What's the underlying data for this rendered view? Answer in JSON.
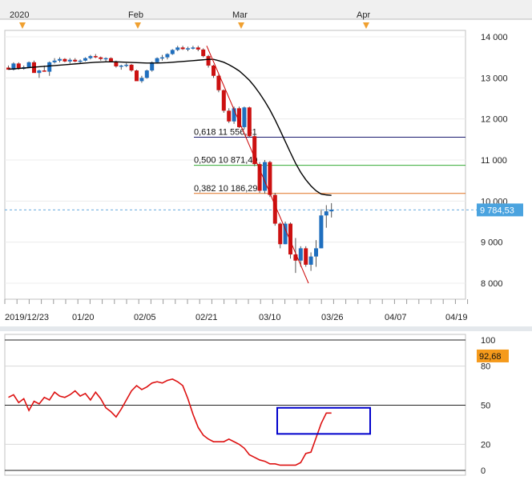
{
  "chart_data": [
    {
      "type": "candlestick",
      "top_axis": {
        "labels": [
          "2020",
          "Feb",
          "Mar",
          "Apr"
        ]
      },
      "y_axis": {
        "ticks": [
          8000,
          9000,
          10000,
          11000,
          12000,
          13000,
          14000
        ],
        "tick_labels": [
          "8 000",
          "9 000",
          "10 000",
          "11 000",
          "12 000",
          "13 000",
          "14 000"
        ],
        "range": [
          7700,
          14150
        ]
      },
      "x_axis": {
        "tick_labels": [
          "2019/12/23",
          "01/20",
          "02/05",
          "02/21",
          "03/10",
          "03/26",
          "04/07",
          "04/19"
        ]
      },
      "current_price": {
        "label": "9 784,53",
        "value": 9784.53,
        "color": "#3399cc"
      },
      "fibonacci_levels": [
        {
          "label": "0,618 11 556,31",
          "value": 11556.31,
          "color": "#1a1a6e"
        },
        {
          "label": "0,500 10 871,40",
          "value": 10871.4,
          "color": "#33aa33"
        },
        {
          "label": "0,382 10 186,29",
          "value": 10186.29,
          "color": "#e07020"
        }
      ],
      "trendline": {
        "from": 13780,
        "to": 8000,
        "color": "#cc0000"
      },
      "colors": {
        "up": "#1f6fbf",
        "down": "#cc1111",
        "moving_average": "#000000",
        "grid": "#cccccc"
      },
      "candles": [
        [
          13250,
          13300,
          13200,
          13200
        ],
        [
          13200,
          13380,
          13180,
          13350
        ],
        [
          13350,
          13380,
          13200,
          13220
        ],
        [
          13220,
          13300,
          13200,
          13260
        ],
        [
          13260,
          13400,
          13250,
          13380
        ],
        [
          13380,
          13420,
          13300,
          13120
        ],
        [
          13120,
          13200,
          13000,
          13180
        ],
        [
          13180,
          13300,
          13150,
          13150
        ],
        [
          13150,
          13400,
          13050,
          13380
        ],
        [
          13380,
          13480,
          13350,
          13420
        ],
        [
          13420,
          13500,
          13380,
          13460
        ],
        [
          13460,
          13480,
          13380,
          13400
        ],
        [
          13400,
          13480,
          13350,
          13440
        ],
        [
          13440,
          13480,
          13380,
          13400
        ],
        [
          13400,
          13450,
          13360,
          13420
        ],
        [
          13420,
          13500,
          13400,
          13480
        ],
        [
          13480,
          13560,
          13450,
          13530
        ],
        [
          13530,
          13580,
          13480,
          13500
        ],
        [
          13500,
          13520,
          13420,
          13460
        ],
        [
          13460,
          13500,
          13400,
          13480
        ],
        [
          13480,
          13500,
          13380,
          13400
        ],
        [
          13400,
          13420,
          13250,
          13280
        ],
        [
          13280,
          13320,
          13200,
          13300
        ],
        [
          13300,
          13360,
          13260,
          13320
        ],
        [
          13320,
          13340,
          13150,
          13180
        ],
        [
          13180,
          13200,
          12950,
          12920
        ],
        [
          12920,
          13050,
          12880,
          13000
        ],
        [
          13000,
          13200,
          12980,
          13180
        ],
        [
          13180,
          13400,
          13150,
          13380
        ],
        [
          13380,
          13500,
          13350,
          13480
        ],
        [
          13480,
          13560,
          13420,
          13500
        ],
        [
          13500,
          13600,
          13450,
          13580
        ],
        [
          13580,
          13700,
          13560,
          13680
        ],
        [
          13680,
          13780,
          13650,
          13740
        ],
        [
          13740,
          13780,
          13680,
          13700
        ],
        [
          13700,
          13760,
          13650,
          13720
        ],
        [
          13720,
          13780,
          13690,
          13740
        ],
        [
          13740,
          13780,
          13650,
          13690
        ],
        [
          13690,
          13720,
          13500,
          13530
        ],
        [
          13530,
          13560,
          13250,
          13300
        ],
        [
          13300,
          13320,
          13000,
          13050
        ],
        [
          13050,
          13080,
          12650,
          12700
        ],
        [
          12700,
          12720,
          12150,
          12200
        ],
        [
          12200,
          12260,
          11900,
          11940
        ],
        [
          11940,
          12300,
          11880,
          12260
        ],
        [
          12260,
          12300,
          11780,
          11800
        ],
        [
          11800,
          12300,
          11750,
          12280
        ],
        [
          12280,
          12300,
          11550,
          11580
        ],
        [
          11580,
          11620,
          10850,
          10900
        ],
        [
          10900,
          10950,
          10200,
          10250
        ],
        [
          10250,
          11000,
          10180,
          10950
        ],
        [
          10950,
          10980,
          10100,
          10150
        ],
        [
          10150,
          10200,
          9400,
          9450
        ],
        [
          9450,
          9480,
          8850,
          8950
        ],
        [
          8950,
          9500,
          8950,
          9450
        ],
        [
          9450,
          9480,
          8600,
          8700
        ],
        [
          8700,
          9100,
          8250,
          8550
        ],
        [
          8550,
          8900,
          8400,
          8850
        ],
        [
          8850,
          8900,
          8400,
          8450
        ],
        [
          8450,
          8750,
          8300,
          8650
        ],
        [
          8650,
          9050,
          8400,
          8850
        ],
        [
          8850,
          9800,
          8850,
          9650
        ],
        [
          9650,
          9900,
          9350,
          9750
        ],
        [
          9750,
          9950,
          9600,
          9790
        ]
      ],
      "moving_average": [
        13210,
        13220,
        13230,
        13240,
        13250,
        13260,
        13270,
        13280,
        13290,
        13300,
        13310,
        13320,
        13330,
        13340,
        13350,
        13360,
        13370,
        13380,
        13385,
        13390,
        13390,
        13390,
        13385,
        13380,
        13375,
        13370,
        13365,
        13360,
        13360,
        13360,
        13365,
        13370,
        13380,
        13390,
        13400,
        13410,
        13420,
        13430,
        13440,
        13450,
        13450,
        13420,
        13380,
        13320,
        13250,
        13170,
        13060,
        12940,
        12790,
        12620,
        12430,
        12220,
        11980,
        11720,
        11450,
        11180,
        10920,
        10700,
        10520,
        10370,
        10250,
        10170,
        10150,
        10140
      ]
    },
    {
      "type": "line",
      "y_axis": {
        "ticks": [
          0,
          20,
          50,
          80,
          100
        ],
        "tick_labels": [
          "0",
          "20",
          "50",
          "80",
          "100"
        ],
        "range": [
          0,
          100
        ]
      },
      "current_value": {
        "label": "92,68",
        "value": 92.68,
        "color": "#ff9900"
      },
      "series": [
        {
          "color": "#dd1111",
          "values": [
            56,
            58,
            52,
            55,
            46,
            53,
            51,
            56,
            54,
            60,
            57,
            56,
            58,
            61,
            57,
            59,
            54,
            60,
            55,
            48,
            45,
            41,
            47,
            54,
            61,
            65,
            62,
            64,
            67,
            68,
            67,
            69,
            70,
            68,
            65,
            55,
            43,
            33,
            27,
            24,
            22,
            22,
            22,
            24,
            22,
            20,
            17,
            12,
            10,
            8,
            7,
            5,
            5,
            4,
            4,
            4,
            4,
            6,
            13,
            14,
            25,
            36,
            44,
            44
          ]
        }
      ],
      "highlight_box": {
        "color": "#0000cc"
      }
    }
  ]
}
